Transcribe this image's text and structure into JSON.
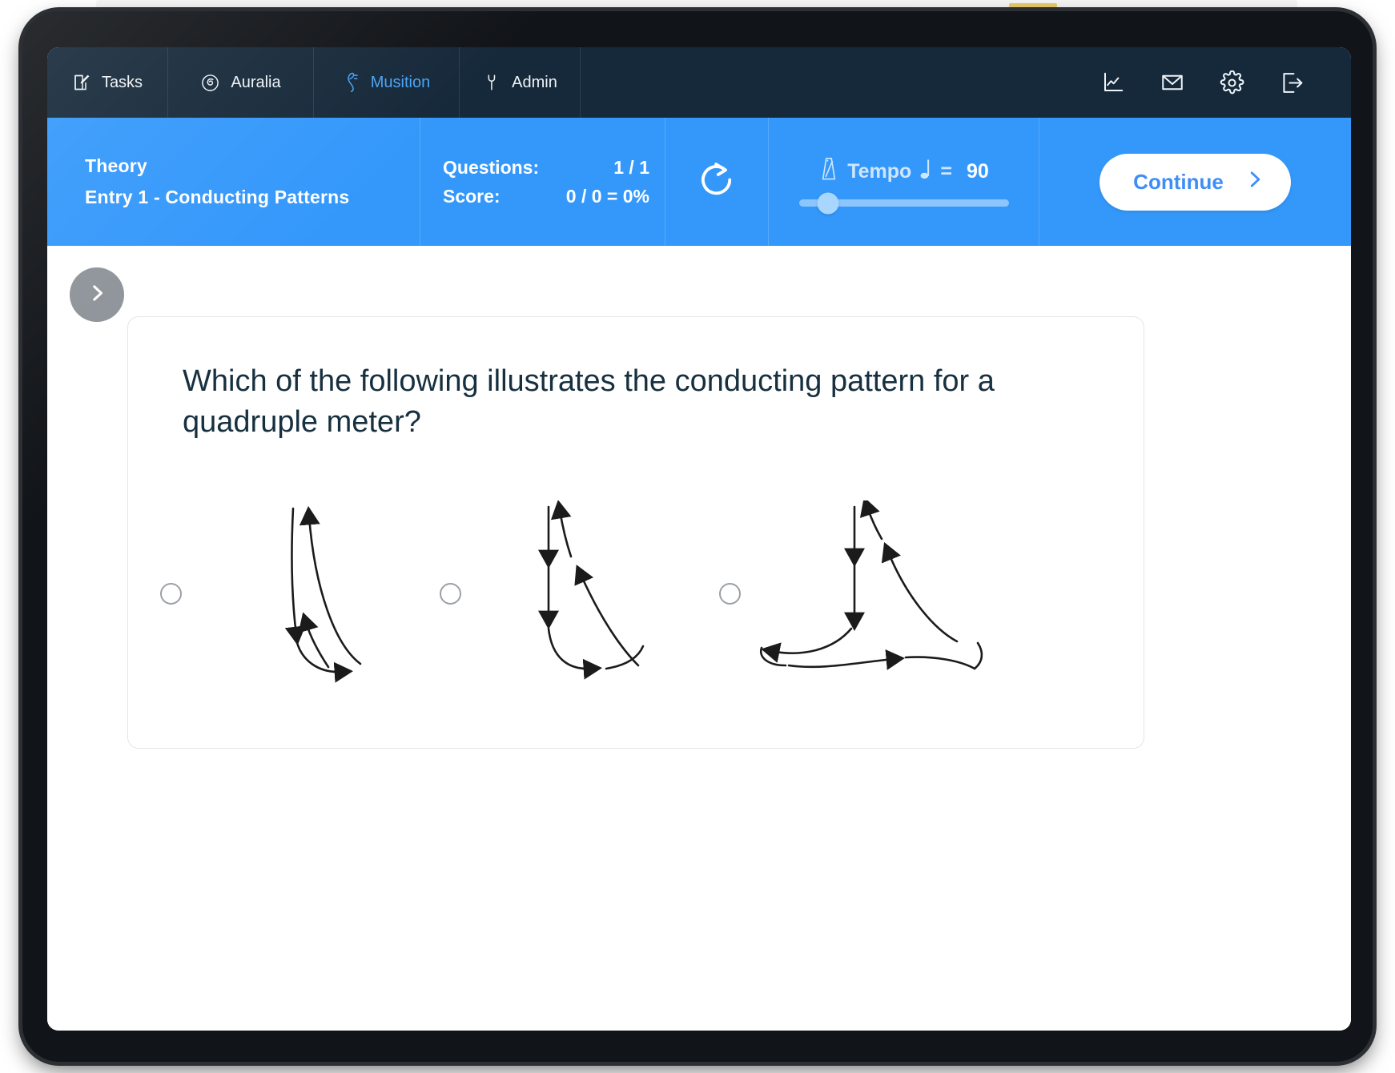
{
  "app": {
    "nav_tabs": [
      {
        "label": "Tasks",
        "icon": "pencil-note-icon",
        "active": false
      },
      {
        "label": "Auralia",
        "icon": "ear-spiral-icon",
        "active": false
      },
      {
        "label": "Musition",
        "icon": "music-clef-icon",
        "active": true
      },
      {
        "label": "Admin",
        "icon": "wrench-icon",
        "active": false
      }
    ],
    "nav_actions": [
      {
        "name": "reports-icon",
        "label": "Reports"
      },
      {
        "name": "mail-icon",
        "label": "Messages"
      },
      {
        "name": "gear-icon",
        "label": "Settings"
      },
      {
        "name": "logout-icon",
        "label": "Log out"
      }
    ]
  },
  "header": {
    "course": "Theory",
    "entry": "Entry 1 - Conducting Patterns",
    "questions_label": "Questions:",
    "questions_value": "1 / 1",
    "score_label": "Score:",
    "score_value": "0 / 0 = 0%",
    "refresh_icon": "refresh-icon",
    "tempo_label": "Tempo",
    "tempo_equals": "=",
    "tempo_value": "90",
    "tempo_slider_percent": 14,
    "continue_label": "Continue",
    "continue_icon": "chevron-right-icon",
    "accent_blue": "#3498fb",
    "nav_dark": "#16293a",
    "active_tab_blue": "#4aa3f5"
  },
  "content": {
    "next_button_icon": "chevron-right-icon",
    "question": "Which of the following illustrates the conducting pattern for a quadruple meter?",
    "options": [
      {
        "id": "option-1",
        "selected": false,
        "diagram": "duple-meter-conducting-pattern"
      },
      {
        "id": "option-2",
        "selected": false,
        "diagram": "triple-meter-conducting-pattern"
      },
      {
        "id": "option-3",
        "selected": false,
        "diagram": "quadruple-meter-conducting-pattern"
      }
    ]
  }
}
